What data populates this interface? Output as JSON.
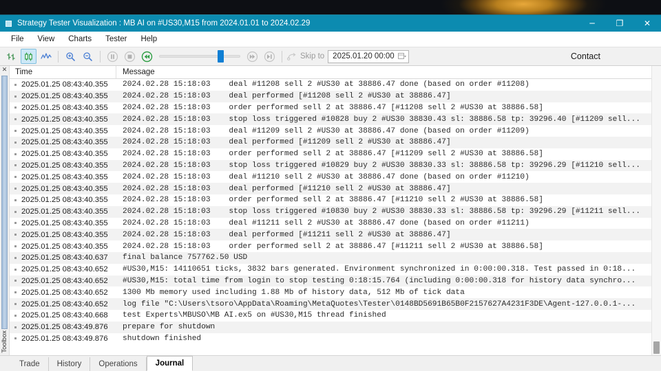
{
  "window": {
    "title": "Strategy Tester Visualization : MB AI on #US30,M15 from 2024.01.01 to 2024.02.29",
    "minimize_label": "─",
    "maximize_label": "❐",
    "close_label": "✕"
  },
  "menu": {
    "items": [
      {
        "label": "File"
      },
      {
        "label": "View"
      },
      {
        "label": "Charts"
      },
      {
        "label": "Tester"
      },
      {
        "label": "Help"
      }
    ]
  },
  "toolbar": {
    "bars_icon": "bar-chart-icon",
    "candles_icon": "candlestick-chart-icon",
    "line_icon": "line-chart-icon",
    "zoom_in_icon": "zoom-in-icon",
    "zoom_out_icon": "zoom-out-icon",
    "pause_icon": "pause-icon",
    "stop_icon": "stop-icon",
    "rewind_icon": "rewind-icon",
    "forward_icon": "fast-forward-icon",
    "skip_icon": "skip-forward-icon",
    "skip_to_label": "Skip to",
    "skip_to_value": "2025.01.20 00:00",
    "skip_dropdown_icon": "chevron-down-icon",
    "contact_label": "Contact",
    "slider_position_percent": 78
  },
  "journal": {
    "columns": {
      "time": "Time",
      "message": "Message"
    },
    "rows": [
      {
        "time": "2025.01.25 08:43:40.355",
        "message": "2024.02.28 15:18:03    deal #11208 sell 2 #US30 at 38886.47 done (based on order #11208)"
      },
      {
        "time": "2025.01.25 08:43:40.355",
        "message": "2024.02.28 15:18:03    deal performed [#11208 sell 2 #US30 at 38886.47]"
      },
      {
        "time": "2025.01.25 08:43:40.355",
        "message": "2024.02.28 15:18:03    order performed sell 2 at 38886.47 [#11208 sell 2 #US30 at 38886.58]"
      },
      {
        "time": "2025.01.25 08:43:40.355",
        "message": "2024.02.28 15:18:03    stop loss triggered #10828 buy 2 #US30 38830.43 sl: 38886.58 tp: 39296.40 [#11209 sell..."
      },
      {
        "time": "2025.01.25 08:43:40.355",
        "message": "2024.02.28 15:18:03    deal #11209 sell 2 #US30 at 38886.47 done (based on order #11209)"
      },
      {
        "time": "2025.01.25 08:43:40.355",
        "message": "2024.02.28 15:18:03    deal performed [#11209 sell 2 #US30 at 38886.47]"
      },
      {
        "time": "2025.01.25 08:43:40.355",
        "message": "2024.02.28 15:18:03    order performed sell 2 at 38886.47 [#11209 sell 2 #US30 at 38886.58]"
      },
      {
        "time": "2025.01.25 08:43:40.355",
        "message": "2024.02.28 15:18:03    stop loss triggered #10829 buy 2 #US30 38830.33 sl: 38886.58 tp: 39296.29 [#11210 sell..."
      },
      {
        "time": "2025.01.25 08:43:40.355",
        "message": "2024.02.28 15:18:03    deal #11210 sell 2 #US30 at 38886.47 done (based on order #11210)"
      },
      {
        "time": "2025.01.25 08:43:40.355",
        "message": "2024.02.28 15:18:03    deal performed [#11210 sell 2 #US30 at 38886.47]"
      },
      {
        "time": "2025.01.25 08:43:40.355",
        "message": "2024.02.28 15:18:03    order performed sell 2 at 38886.47 [#11210 sell 2 #US30 at 38886.58]"
      },
      {
        "time": "2025.01.25 08:43:40.355",
        "message": "2024.02.28 15:18:03    stop loss triggered #10830 buy 2 #US30 38830.33 sl: 38886.58 tp: 39296.29 [#11211 sell..."
      },
      {
        "time": "2025.01.25 08:43:40.355",
        "message": "2024.02.28 15:18:03    deal #11211 sell 2 #US30 at 38886.47 done (based on order #11211)"
      },
      {
        "time": "2025.01.25 08:43:40.355",
        "message": "2024.02.28 15:18:03    deal performed [#11211 sell 2 #US30 at 38886.47]"
      },
      {
        "time": "2025.01.25 08:43:40.355",
        "message": "2024.02.28 15:18:03    order performed sell 2 at 38886.47 [#11211 sell 2 #US30 at 38886.58]"
      },
      {
        "time": "2025.01.25 08:43:40.637",
        "message": "final balance 757762.50 USD"
      },
      {
        "time": "2025.01.25 08:43:40.652",
        "message": "#US30,M15: 14110651 ticks, 3832 bars generated. Environment synchronized in 0:00:00.318. Test passed in 0:18..."
      },
      {
        "time": "2025.01.25 08:43:40.652",
        "message": "#US30,M15: total time from login to stop testing 0:18:15.764 (including 0:00:00.318 for history data synchro..."
      },
      {
        "time": "2025.01.25 08:43:40.652",
        "message": "1300 Mb memory used including 1.88 Mb of history data, 512 Mb of tick data"
      },
      {
        "time": "2025.01.25 08:43:40.652",
        "message": "log file \"C:\\Users\\tsoro\\AppData\\Roaming\\MetaQuotes\\Tester\\0148BD5691B65B0F2157627A4231F3DE\\Agent-127.0.0.1-..."
      },
      {
        "time": "2025.01.25 08:43:40.668",
        "message": "test Experts\\MBUSO\\MB AI.ex5 on #US30,M15 thread finished"
      },
      {
        "time": "2025.01.25 08:43:49.876",
        "message": "prepare for shutdown"
      },
      {
        "time": "2025.01.25 08:43:49.876",
        "message": "shutdown finished"
      }
    ]
  },
  "toolbox": {
    "rail_label": "Toolbox",
    "close_icon": "close-icon",
    "tabs": [
      {
        "label": "Trade",
        "active": false
      },
      {
        "label": "History",
        "active": false
      },
      {
        "label": "Operations",
        "active": false
      },
      {
        "label": "Journal",
        "active": true
      }
    ]
  },
  "colors": {
    "titlebar": "#0c8bb0",
    "accent_blue": "#0f7fd4",
    "active_tool": "#cde8f7",
    "row_alt": "#f2f2f2",
    "rewind_green": "#2e9e44"
  }
}
